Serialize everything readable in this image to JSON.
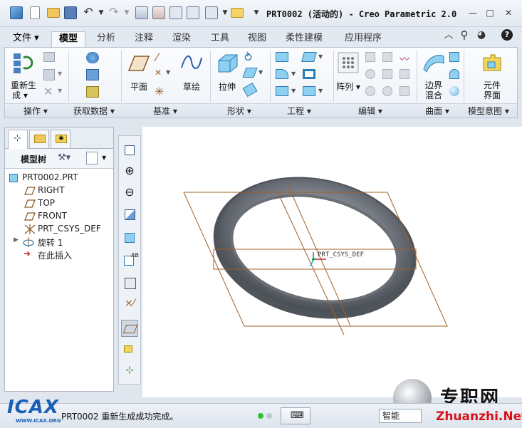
{
  "window": {
    "title": "PRT0002 (活动的) - Creo Parametric 2.0"
  },
  "quick_access": {
    "icons": [
      "app-logo-icon",
      "new-file-icon",
      "open-file-icon",
      "save-icon",
      "undo-icon",
      "redo-icon",
      "regenerate-icon",
      "window-icon",
      "close-window-icon",
      "customize-icon"
    ]
  },
  "tabs": [
    {
      "label": "文件"
    },
    {
      "label": "模型"
    },
    {
      "label": "分析"
    },
    {
      "label": "注释"
    },
    {
      "label": "渲染"
    },
    {
      "label": "工具"
    },
    {
      "label": "视图"
    },
    {
      "label": "柔性建模"
    },
    {
      "label": "应用程序"
    }
  ],
  "ribbon": {
    "operations": {
      "regenerate": "重新生",
      "regenerate_2": "成",
      "label": "操作"
    },
    "get_data": {
      "label": "获取数据"
    },
    "datum": {
      "plane": "平面",
      "sketch": "草绘",
      "label": "基准"
    },
    "shapes": {
      "extrude": "拉伸",
      "label": "形状"
    },
    "engineering": {
      "label": "工程"
    },
    "editing": {
      "pattern": "阵列",
      "label": "编辑"
    },
    "surfaces": {
      "boundary_blend": "边界",
      "boundary_blend_2": "混合",
      "label": "曲面"
    },
    "model_intent": {
      "component_interface": "元件",
      "component_interface_2": "界面",
      "label": "模型意图"
    }
  },
  "left_panel": {
    "tree_title": "模型树",
    "items": [
      {
        "label": "PRT0002.PRT",
        "icon": "part-icon"
      },
      {
        "label": "RIGHT",
        "icon": "datum-plane-icon"
      },
      {
        "label": "TOP",
        "icon": "datum-plane-icon"
      },
      {
        "label": "FRONT",
        "icon": "datum-plane-icon"
      },
      {
        "label": "PRT_CSYS_DEF",
        "icon": "csys-icon"
      },
      {
        "label": "旋转 1",
        "icon": "revolve-icon"
      },
      {
        "label": "在此插入",
        "icon": "insert-here-icon"
      }
    ]
  },
  "graphics": {
    "csys_label": "PRT_CSYS_DEF",
    "toolbar_icons": [
      "refit-icon",
      "zoom-in-icon",
      "zoom-out-icon",
      "repaint-icon",
      "display-style-icon",
      "saved-orientations-icon",
      "view-manager-icon",
      "datum-display-filter-icon",
      "spin-center-icon",
      "annotation-display-icon",
      "csys-display-icon"
    ]
  },
  "status": {
    "message": "PRT0002 重新生成成功完成。",
    "filter": "智能"
  },
  "watermark": {
    "left_brand": "ICAX",
    "left_url": "WWW.ICAX.ORG",
    "right_brand": "专职网",
    "right_url": "Zhuanzhi.Net"
  },
  "colors": {
    "ribbon_bg": "#eef2f7",
    "tab_active": "#f7f9fc",
    "datum_plane": "#a0602a",
    "torus": "#5a5f66",
    "watermark_red": "#d9101a"
  }
}
